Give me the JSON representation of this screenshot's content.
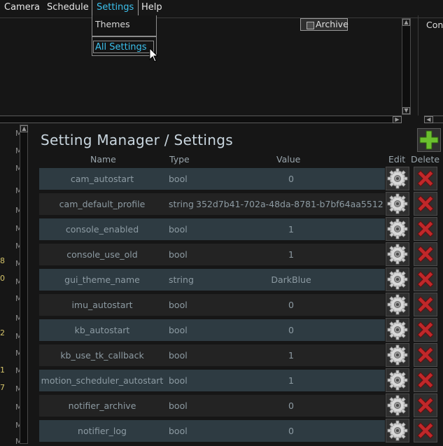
{
  "menubar": {
    "items": [
      {
        "label": "Camera"
      },
      {
        "label": "Schedule"
      },
      {
        "label": "Settings"
      },
      {
        "label": "Help"
      }
    ]
  },
  "dropdown": {
    "items": [
      {
        "label": "Themes"
      },
      {
        "label": "All Settings"
      }
    ]
  },
  "top_panel": {
    "archive_label": "Archive",
    "right_label": "Con"
  },
  "log_column": {
    "numbers": [
      "8",
      "0",
      "2",
      "1",
      "7"
    ],
    "marker": "M"
  },
  "settings_panel": {
    "title": "Setting Manager / Settings",
    "columns": {
      "name": "Name",
      "type": "Type",
      "value": "Value",
      "edit": "Edit",
      "delete": "Delete"
    },
    "rows": [
      {
        "name": "cam_autostart",
        "type": "bool",
        "value": "0"
      },
      {
        "name": "cam_default_profile",
        "type": "string",
        "value": "352d7b41-702a-48da-8781-b7bf64aa5512"
      },
      {
        "name": "console_enabled",
        "type": "bool",
        "value": "1"
      },
      {
        "name": "console_use_old",
        "type": "bool",
        "value": "1"
      },
      {
        "name": "gui_theme_name",
        "type": "string",
        "value": "DarkBlue"
      },
      {
        "name": "imu_autostart",
        "type": "bool",
        "value": "0"
      },
      {
        "name": "kb_autostart",
        "type": "bool",
        "value": "0"
      },
      {
        "name": "kb_use_tk_callback",
        "type": "bool",
        "value": "1"
      },
      {
        "name": "motion_scheduler_autostart",
        "type": "bool",
        "value": "1"
      },
      {
        "name": "notifier_archive",
        "type": "bool",
        "value": "0"
      },
      {
        "name": "notifier_log",
        "type": "bool",
        "value": "0"
      }
    ]
  },
  "colors": {
    "accent": "#3cc0ec",
    "row_odd": "#2e3b42",
    "row_even": "#232323",
    "add_green": "#6abf2e",
    "delete_red": "#c0282a"
  }
}
